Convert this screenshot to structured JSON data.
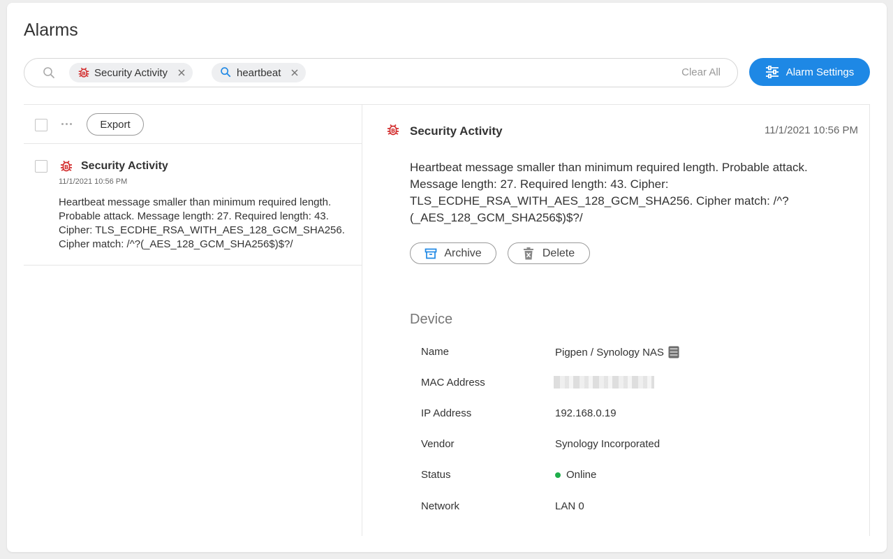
{
  "page": {
    "title": "Alarms"
  },
  "filters": {
    "chips": [
      {
        "label": "Security Activity",
        "icon": "bug-icon"
      },
      {
        "label": "heartbeat",
        "icon": "search-icon"
      }
    ],
    "clear_all": "Clear All"
  },
  "alarm_settings_button": "Alarm Settings",
  "toolbar": {
    "export_label": "Export"
  },
  "list": {
    "items": [
      {
        "title": "Security Activity",
        "time": "11/1/2021 10:56 PM",
        "message": "Heartbeat message smaller than minimum required length. Probable attack. Message length: 27. Required length: 43. Cipher: TLS_ECDHE_RSA_WITH_AES_128_GCM_SHA256. Cipher match: /^?(_AES_128_GCM_SHA256$)$?/"
      }
    ]
  },
  "detail": {
    "title": "Security Activity",
    "time": "11/1/2021 10:56 PM",
    "message": "Heartbeat message smaller than minimum required length. Probable attack. Message length: 27. Required length: 43. Cipher: TLS_ECDHE_RSA_WITH_AES_128_GCM_SHA256. Cipher match: /^?(_AES_128_GCM_SHA256$)$?/",
    "archive_label": "Archive",
    "delete_label": "Delete",
    "device": {
      "heading": "Device",
      "rows": [
        {
          "label": "Name",
          "value": "Pigpen / Synology NAS"
        },
        {
          "label": "MAC Address",
          "value": ""
        },
        {
          "label": "IP Address",
          "value": "192.168.0.19"
        },
        {
          "label": "Vendor",
          "value": "Synology Incorporated"
        },
        {
          "label": "Status",
          "value": "Online"
        },
        {
          "label": "Network",
          "value": "LAN 0"
        }
      ]
    }
  },
  "colors": {
    "accent": "#1e88e5",
    "alert": "#d32f2f",
    "online": "#1fae4b"
  }
}
